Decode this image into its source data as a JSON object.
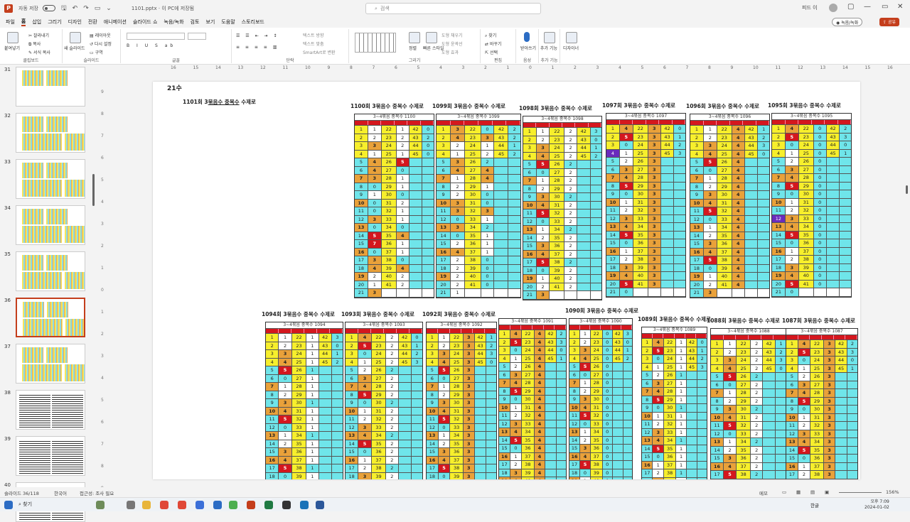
{
  "titlebar": {
    "autosave": "자동 저장",
    "file": "1101.pptx · 이 PC에 저장됨",
    "search_placeholder": "검색",
    "user": "피드 이"
  },
  "menu": [
    "파일",
    "홈",
    "삽입",
    "그리기",
    "디자인",
    "전환",
    "애니메이션",
    "슬라이드 쇼",
    "녹음/녹화",
    "검토",
    "보기",
    "도움말",
    "스토리보드"
  ],
  "record_label": "녹음/녹화",
  "share_label": "공유",
  "ribbon": {
    "clipboard": {
      "paste": "붙여넣기",
      "cut": "잘라내기",
      "copy": "복사",
      "format": "서식 복사",
      "label": "클립보드"
    },
    "slides": {
      "new": "새 슬라이드",
      "layout": "레이아웃",
      "reset": "다시 설정",
      "section": "구역",
      "label": "슬라이드"
    },
    "font_label": "글꼴",
    "para_label": "단락",
    "para_items": [
      "텍스트 방향",
      "텍스트 맞춤",
      "SmartArt로 변환"
    ],
    "drawing": {
      "arrange": "정렬",
      "quick": "빠른 스타일",
      "fill": "도형 채우기",
      "outline": "도형 윤곽선",
      "effect": "도형 효과",
      "label": "그리기"
    },
    "edit": {
      "find": "찾기",
      "replace": "바꾸기",
      "select": "선택",
      "label": "편집"
    },
    "voice": {
      "dictate": "받아쓰기",
      "label": "음성"
    },
    "addins": {
      "add": "추가 기능",
      "label": "추가 기능"
    },
    "designer": "디자이너"
  },
  "ruler_h": [
    "16",
    "15",
    "14",
    "13",
    "12",
    "11",
    "10",
    "9",
    "8",
    "7",
    "6",
    "5",
    "4",
    "3",
    "2",
    "1",
    "0",
    "1",
    "2",
    "3",
    "4",
    "5",
    "6",
    "7",
    "8",
    "9",
    "10",
    "11",
    "12",
    "13",
    "14",
    "15",
    "16"
  ],
  "ruler_v": [
    "9",
    "8",
    "7",
    "6",
    "5",
    "4",
    "3",
    "2",
    "1",
    "0",
    "1",
    "2",
    "3",
    "4",
    "5",
    "6",
    "7",
    "8",
    "9"
  ],
  "thumbs": [
    "31",
    "32",
    "33",
    "34",
    "35",
    "36",
    "37",
    "38",
    "39",
    "40"
  ],
  "slide": {
    "title": "21수",
    "caption_1101": {
      "pre": "1101회 3",
      "mid": "묶음수 중복수",
      "post": " 수제로"
    },
    "tables": [
      {
        "cap": "1100회 3묶음수 중복수 수제로",
        "head": "3~4묶음 중복수 1100"
      },
      {
        "cap": "1099회 3묶음수 중복수 수제로",
        "head": "3~4묶음 중복수 1099"
      },
      {
        "cap": "1098회 3묶음수 중복수 수제로",
        "head": "3~4묶음 중복수 1098"
      },
      {
        "cap": "1097회 3묶음수 중복수 수제로",
        "head": "3~4묶음 중복수 1097"
      },
      {
        "cap": "1096회 3묶음수 중복수 수제로",
        "head": "3~4묶음 중복수 1096"
      },
      {
        "cap": "1095회 3묶음수 중복수 수제로",
        "head": "3~4묶음 중복수 1095"
      },
      {
        "cap": "1094회 3묶음수 중복수 수제로",
        "head": "3~4묶음 중복수 1094"
      },
      {
        "cap": "1093회 3묶음수 중복수 수제로",
        "head": "3~4묶음 중복수 1093"
      },
      {
        "cap": "1092회 3묶음수 중복수 수제로",
        "head": "3~4묶음 중복수 1092"
      },
      {
        "cap": "",
        "head": "3~4묶음 중복수 1091"
      },
      {
        "cap": "1090회 3묶음수 중복수 수제로",
        "head": "3~4묶음 중복수 1090"
      },
      {
        "cap": "1089회 3묶음수 중복수 수제로",
        "head": "3~4묶음 중복수 1089"
      },
      {
        "cap": "1088회 3묶음수 중복수 수제로",
        "head": "3~4묶음 중복수 1088"
      },
      {
        "cap": "1087회 3묶음수 중복수 수제로",
        "head": "3~4묶음 중복수 1087"
      }
    ],
    "grid_1100": [
      [
        "1",
        "1",
        "22",
        "1",
        "42",
        "0"
      ],
      [
        "2",
        "2",
        "23",
        "2",
        "43",
        "2"
      ],
      [
        "3",
        "3",
        "24",
        "2",
        "44",
        "0"
      ],
      [
        "4",
        "1",
        "25",
        "1",
        "45",
        "0"
      ],
      [
        "5",
        "4",
        "26",
        "5",
        "",
        ""
      ],
      [
        "6",
        "4",
        "27",
        "0",
        "",
        ""
      ],
      [
        "7",
        "3",
        "28",
        "1",
        "",
        ""
      ],
      [
        "8",
        "0",
        "29",
        "1",
        "",
        ""
      ],
      [
        "9",
        "1",
        "30",
        "0",
        "",
        ""
      ],
      [
        "10",
        "0",
        "31",
        "2",
        "",
        ""
      ],
      [
        "11",
        "0",
        "32",
        "1",
        "",
        ""
      ],
      [
        "12",
        "3",
        "33",
        "1",
        "",
        ""
      ],
      [
        "13",
        "0",
        "34",
        "0",
        "",
        ""
      ],
      [
        "14",
        "5",
        "35",
        "4",
        "",
        ""
      ],
      [
        "15",
        "7",
        "36",
        "1",
        "",
        ""
      ],
      [
        "16",
        "0",
        "37",
        "1",
        "",
        ""
      ],
      [
        "17",
        "3",
        "38",
        "0",
        "",
        ""
      ],
      [
        "18",
        "4",
        "39",
        "4",
        "",
        ""
      ],
      [
        "19",
        "2",
        "40",
        "2",
        "",
        ""
      ],
      [
        "20",
        "1",
        "41",
        "2",
        "",
        ""
      ],
      [
        "21",
        "3",
        "",
        ""
      ]
    ],
    "grid_1099": [
      [
        "1",
        "3",
        "22",
        "0",
        "42",
        "2"
      ],
      [
        "2",
        "4",
        "23",
        "3",
        "43",
        "2"
      ],
      [
        "3",
        "2",
        "24",
        "1",
        "44",
        "1"
      ],
      [
        "4",
        "1",
        "25",
        "2",
        "45",
        "2"
      ],
      [
        "5",
        "3",
        "26",
        "2",
        "",
        ""
      ],
      [
        "6",
        "4",
        "27",
        "4",
        "",
        ""
      ],
      [
        "7",
        "1",
        "28",
        "4",
        "",
        ""
      ],
      [
        "8",
        "2",
        "29",
        "1",
        "",
        ""
      ],
      [
        "9",
        "2",
        "30",
        "0",
        "",
        ""
      ],
      [
        "10",
        "3",
        "31",
        "0",
        "",
        ""
      ],
      [
        "11",
        "3",
        "32",
        "3",
        "",
        ""
      ],
      [
        "12",
        "0",
        "33",
        "1",
        "",
        ""
      ],
      [
        "13",
        "3",
        "34",
        "2",
        "",
        ""
      ],
      [
        "14",
        "0",
        "35",
        "1",
        "",
        ""
      ],
      [
        "15",
        "2",
        "36",
        "1",
        "",
        ""
      ],
      [
        "16",
        "4",
        "37",
        "1",
        "",
        ""
      ],
      [
        "17",
        "2",
        "38",
        "0",
        "",
        ""
      ],
      [
        "18",
        "2",
        "39",
        "0",
        "",
        ""
      ],
      [
        "19",
        "2",
        "40",
        "0",
        "",
        ""
      ],
      [
        "20",
        "2",
        "41",
        "0",
        "",
        ""
      ],
      [
        "21",
        "1",
        "",
        ""
      ]
    ]
  },
  "status": {
    "slide": "슬라이드 36/118",
    "lang": "한국어",
    "access": "접근성: 조사 필요",
    "notes": "메모",
    "zoom": "156%"
  },
  "taskbar": {
    "search": "찾기",
    "time": "오후 7:09",
    "date": "2024-01-02",
    "lang": "한글"
  }
}
